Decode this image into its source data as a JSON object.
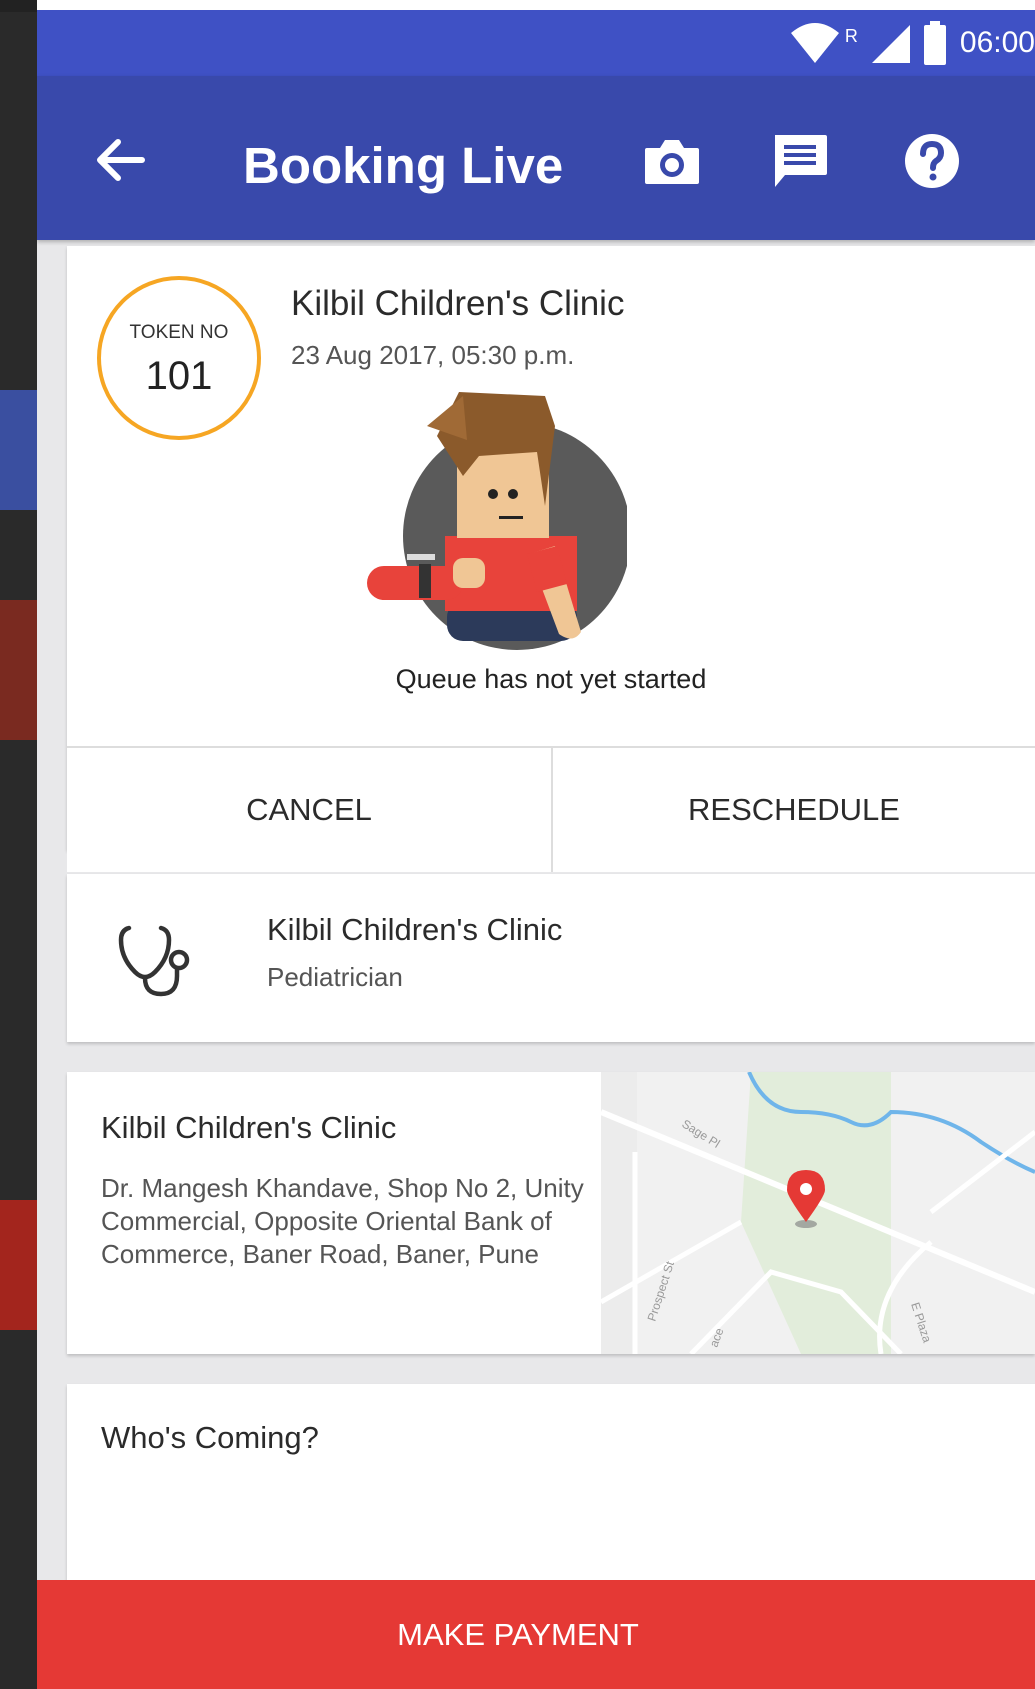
{
  "status_bar": {
    "time": "06:00",
    "roaming_indicator": "R",
    "icons": [
      "wifi-icon",
      "signal-icon",
      "battery-icon"
    ]
  },
  "app_bar": {
    "title": "Booking Live",
    "back_icon": "arrow-back-icon",
    "actions": [
      "camera-icon",
      "message-icon",
      "help-icon"
    ]
  },
  "booking_card": {
    "token_label": "TOKEN NO",
    "token_number": "101",
    "clinic_name": "Kilbil Children's Clinic",
    "date_time": "23 Aug 2017, 05:30 p.m.",
    "queue_status": "Queue has not yet started",
    "cancel_label": "CANCEL",
    "reschedule_label": "RESCHEDULE"
  },
  "doctor_card": {
    "name": "Kilbil Children's Clinic",
    "speciality": "Pediatrician",
    "icon": "stethoscope-icon"
  },
  "address_card": {
    "title": "Kilbil Children's Clinic",
    "address": "Dr. Mangesh Khandave, Shop No 2, Unity Commercial, Opposite Oriental Bank of Commerce, Baner Road, Baner, Pune",
    "map_labels": [
      "Prospect St",
      "Sage Pl",
      "E Plaza",
      "ace"
    ],
    "map_pin": "map-pin-icon"
  },
  "coming_card": {
    "title": "Who's Coming?"
  },
  "footer": {
    "payment_label": "MAKE PAYMENT"
  },
  "colors": {
    "status_bar": "#3f51c5",
    "app_bar": "#3949ab",
    "token_ring": "#f6a623",
    "payment_bar": "#e53935",
    "map_pin": "#e53935"
  }
}
